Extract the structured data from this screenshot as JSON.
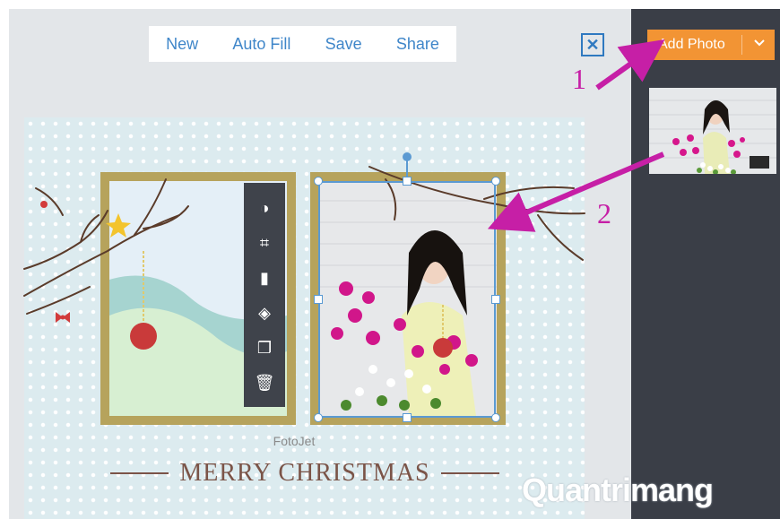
{
  "toolbar": {
    "new_label": "New",
    "autofill_label": "Auto Fill",
    "save_label": "Save",
    "share_label": "Share"
  },
  "close": {
    "glyph": "✕"
  },
  "sidebar": {
    "add_photo_label": "Add Photo",
    "chevron": "⌄"
  },
  "tools": {
    "items": [
      {
        "icon": "contrast-icon",
        "glyph": "◑"
      },
      {
        "icon": "crop-icon",
        "glyph": "⌗"
      },
      {
        "icon": "flip-icon",
        "glyph": "▮"
      },
      {
        "icon": "layers-icon",
        "glyph": "◈"
      },
      {
        "icon": "duplicate-icon",
        "glyph": "❐"
      },
      {
        "icon": "delete-icon",
        "glyph": "🗑"
      }
    ]
  },
  "card": {
    "brand": "FotoJet",
    "title": "MERRY CHRISTMAS"
  },
  "annotations": {
    "step1": "1",
    "step2": "2"
  },
  "watermark": {
    "text": "Quantrimang"
  },
  "colors": {
    "accent": "#f29434",
    "link": "#3f86c9",
    "panel": "#3a3e47",
    "annotation": "#c61fa6",
    "frame": "#b6a35c"
  }
}
